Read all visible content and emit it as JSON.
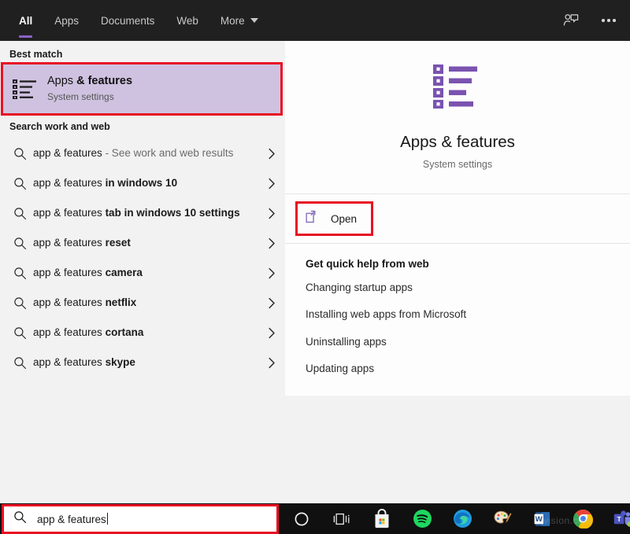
{
  "header": {
    "tabs": [
      {
        "label": "All",
        "active": true
      },
      {
        "label": "Apps",
        "active": false
      },
      {
        "label": "Documents",
        "active": false
      },
      {
        "label": "Web",
        "active": false
      },
      {
        "label": "More",
        "active": false,
        "has_chevron": true
      }
    ],
    "feedback_icon": "feedback-person-icon",
    "overflow_icon": "ellipsis-icon",
    "accent_color": "#8a62c8",
    "background_color": "#202020"
  },
  "left_panel": {
    "best_match_label": "Best match",
    "best_match": {
      "title_normal": "Apps ",
      "title_bold": "& features",
      "subtitle": "System settings",
      "icon": "apps-features-list-icon",
      "highlighted": true,
      "highlight_color": "#e81123",
      "selected_background": "#cfc2e0"
    },
    "search_section_label": "Search work and web",
    "results": [
      {
        "prefix": "app & features",
        "suffix": "",
        "trailing_dim": " - See work and web results",
        "icon": "search-icon",
        "chevron": "chevron-right-icon"
      },
      {
        "prefix": "app & features ",
        "suffix": "in windows 10",
        "trailing_dim": "",
        "icon": "search-icon",
        "chevron": "chevron-right-icon"
      },
      {
        "prefix": "app & features ",
        "suffix": "tab in windows 10 settings",
        "trailing_dim": "",
        "icon": "search-icon",
        "chevron": "chevron-right-icon"
      },
      {
        "prefix": "app & features ",
        "suffix": "reset",
        "trailing_dim": "",
        "icon": "search-icon",
        "chevron": "chevron-right-icon"
      },
      {
        "prefix": "app & features ",
        "suffix": "camera",
        "trailing_dim": "",
        "icon": "search-icon",
        "chevron": "chevron-right-icon"
      },
      {
        "prefix": "app & features ",
        "suffix": "netflix",
        "trailing_dim": "",
        "icon": "search-icon",
        "chevron": "chevron-right-icon"
      },
      {
        "prefix": "app & features ",
        "suffix": "cortana",
        "trailing_dim": "",
        "icon": "search-icon",
        "chevron": "chevron-right-icon"
      },
      {
        "prefix": "app & features ",
        "suffix": "skype",
        "trailing_dim": "",
        "icon": "search-icon",
        "chevron": "chevron-right-icon"
      }
    ]
  },
  "preview": {
    "hero_icon": "apps-features-large-icon",
    "hero_icon_color": "#7a53b0",
    "title": "Apps & features",
    "subtitle": "System settings",
    "open_button": {
      "label": "Open",
      "icon": "open-external-icon",
      "highlighted": true,
      "highlight_color": "#e81123"
    },
    "help_title": "Get quick help from web",
    "help_links": [
      "Changing startup apps",
      "Installing web apps from Microsoft",
      "Uninstalling apps",
      "Updating apps"
    ]
  },
  "taskbar": {
    "search_value": "app & features",
    "search_icon": "search-icon",
    "search_highlighted": true,
    "search_highlight_color": "#e81123",
    "icons": [
      {
        "name": "cortana-icon",
        "label": "Cortana"
      },
      {
        "name": "task-view-icon",
        "label": "Task View"
      },
      {
        "name": "microsoft-store-icon",
        "label": "Microsoft Store"
      },
      {
        "name": "spotify-icon",
        "label": "Spotify"
      },
      {
        "name": "microsoft-edge-icon",
        "label": "Microsoft Edge"
      },
      {
        "name": "paint-icon",
        "label": "Paint"
      },
      {
        "name": "microsoft-word-icon",
        "label": "Word"
      },
      {
        "name": "google-chrome-icon",
        "label": "Chrome"
      },
      {
        "name": "microsoft-teams-icon",
        "label": "Teams"
      }
    ],
    "watermark": "vision.com"
  }
}
